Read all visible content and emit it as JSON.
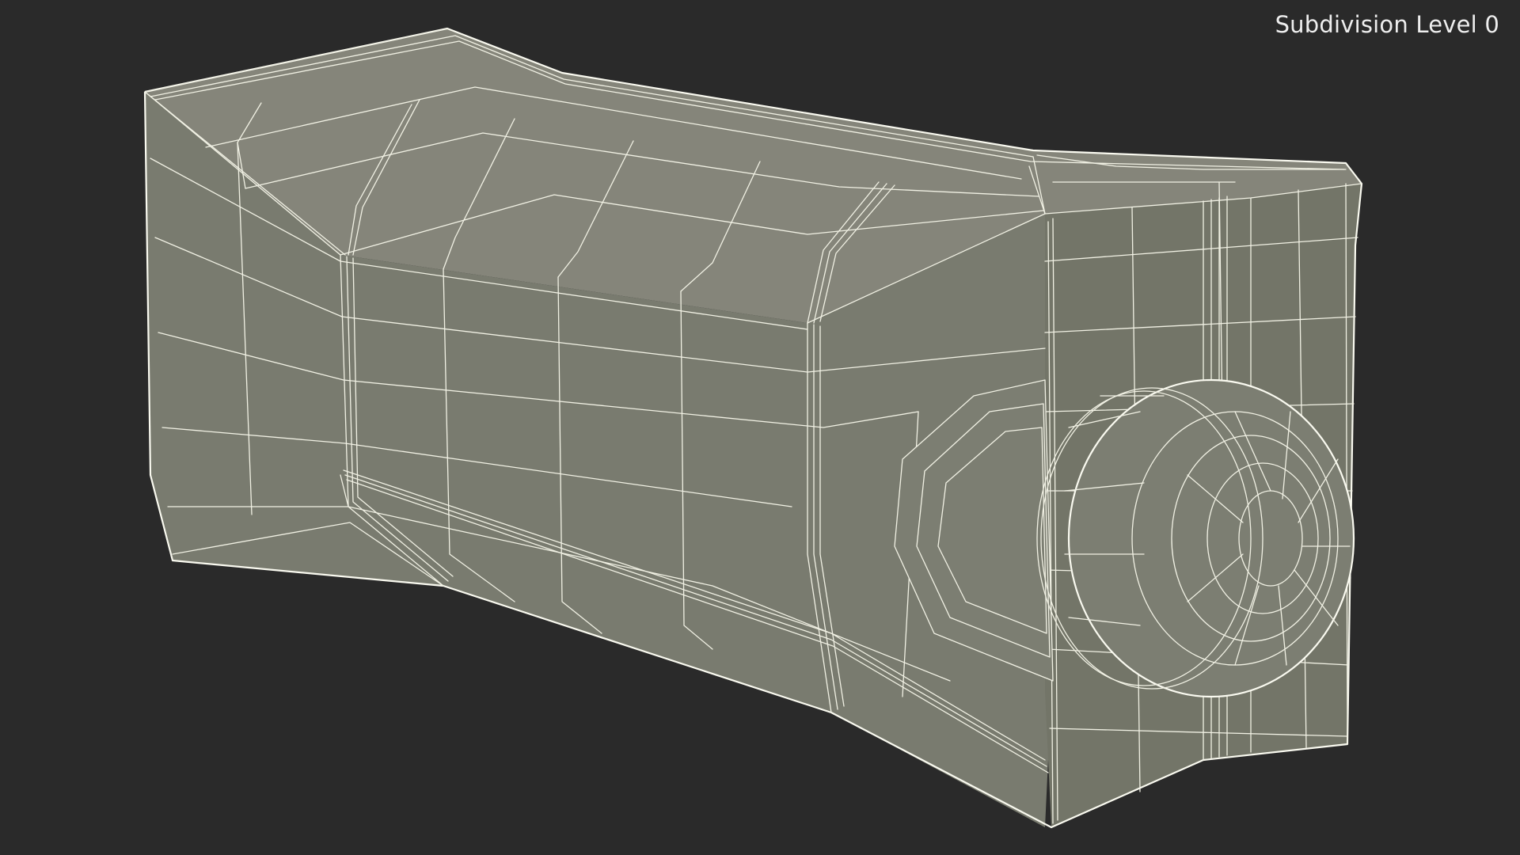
{
  "viewport": {
    "background_color": "#2a2a2a",
    "overlay_label": "Subdivision Level 0",
    "overlay_label_color": "#eeeeee"
  },
  "model": {
    "render_style": "wireframe-on-shaded",
    "surface_color": "#7a7c70",
    "wire_color": "#f1f1e4"
  }
}
